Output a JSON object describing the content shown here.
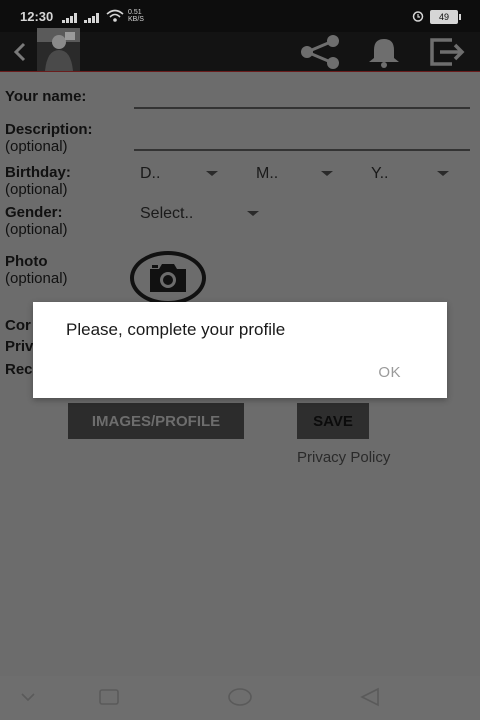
{
  "status_bar": {
    "time": "12:30",
    "net_speed": "0.51",
    "net_unit": "KB/S",
    "battery": "49"
  },
  "app_bar": {
    "icons": [
      "back-arrow-icon",
      "avatar",
      "share-icon",
      "bell-icon",
      "logout-icon"
    ]
  },
  "form": {
    "name_label": "Your name:",
    "description_label": "Description:",
    "description_optional": "(optional)",
    "birthday_label": "Birthday:",
    "birthday_optional": "(optional)",
    "day_placeholder": "D..",
    "month_placeholder": "M..",
    "year_placeholder": "Y..",
    "gender_label": "Gender:",
    "gender_optional": "(optional)",
    "gender_placeholder": "Select..",
    "photo_label": "Photo",
    "photo_optional": "(optional)",
    "row1_partial": "Cor",
    "row2_partial": "Priv",
    "row3_partial": "Rec",
    "images_button": "IMAGES/PROFILE",
    "save_button": "SAVE",
    "privacy_link": "Privacy Policy"
  },
  "dialog": {
    "message": "Please, complete your profile",
    "ok_label": "OK"
  },
  "colors": {
    "status_bar_bg": "#0d0d0d",
    "app_bar_bg": "#131313",
    "dim_background": "#6c6c6c",
    "dialog_bg": "#ffffff"
  }
}
